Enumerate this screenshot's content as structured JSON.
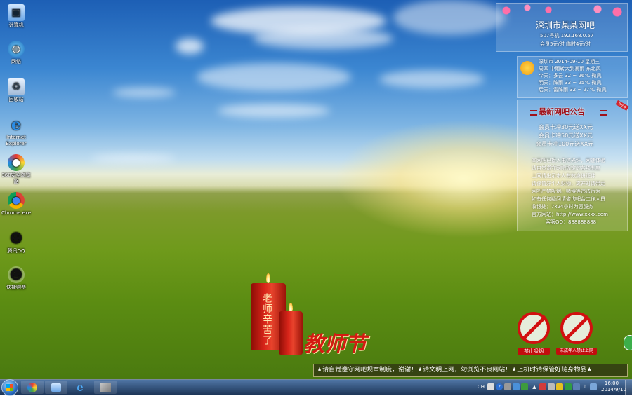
{
  "desktop_icons": [
    {
      "label": "计算机",
      "icon": "computer-icon"
    },
    {
      "label": "网络",
      "icon": "network-icon"
    },
    {
      "label": "回收站",
      "icon": "recycle-bin-icon"
    },
    {
      "label": "Internet Explorer",
      "icon": "ie-icon"
    },
    {
      "label": "360安全浏览器",
      "icon": "browser-360-icon"
    },
    {
      "label": "Chrome.exe",
      "icon": "chrome-icon"
    },
    {
      "label": "腾讯QQ",
      "icon": "qq-icon"
    },
    {
      "label": "快捷购票",
      "icon": "penguin-icon"
    }
  ],
  "info_panel": {
    "title": "深圳市某某网吧",
    "line1": "507号机  192.168.0.57",
    "line2": "会员5元/时  临时4元/时"
  },
  "weather": {
    "date_line": "深圳市 2014-09-10 星期三",
    "row1": "周四 中雨转大到暴雨  东北风",
    "row2": "今天：多云 32 ~ 26℃ 微风",
    "row3": "明天：阵雨 33 ~ 25℃ 微风",
    "row4": "后天：雷阵雨 32 ~ 27℃ 微风"
  },
  "notice": {
    "title": "最新网吧公告",
    "ribbon": "new",
    "offers": [
      "会员卡冲30元送XX元",
      "会员卡冲50元送XX元",
      "会员卡冲100元送XX元"
    ],
    "body": [
      "本网吧已接入电信光纤，网速体验",
      "请自觉遵守网吧规定的各项制度",
      "上网请出示本人有效身份证件",
      "请保管好个人财物，离开时请带走",
      "网吧严禁吸烟、赌博等违法行为",
      "如有任何疑问请咨询吧台工作人员",
      "收银处：7x24小时为您服务",
      "官方网站：http://www.xxxx.com",
      "客服QQ：888888888"
    ]
  },
  "candles_text": "老师辛苦了",
  "teachers_day": "教师节",
  "signs": [
    {
      "label": "禁止吸烟",
      "icon": "no-smoking-icon"
    },
    {
      "label": "未成年人禁止上网",
      "icon": "no-minors-icon"
    }
  ],
  "ticker": "★请自觉遵守网吧规章制度，谢谢！★请文明上网，勿浏览不良网站！★上机时请保管好随身物品★",
  "taskbar": {
    "clock_time": "16:00",
    "clock_date": "2014/9/10",
    "tray_lang": "CH"
  },
  "colors": {
    "accent_red": "#c30d0d",
    "panel_title": "#a0121a"
  }
}
